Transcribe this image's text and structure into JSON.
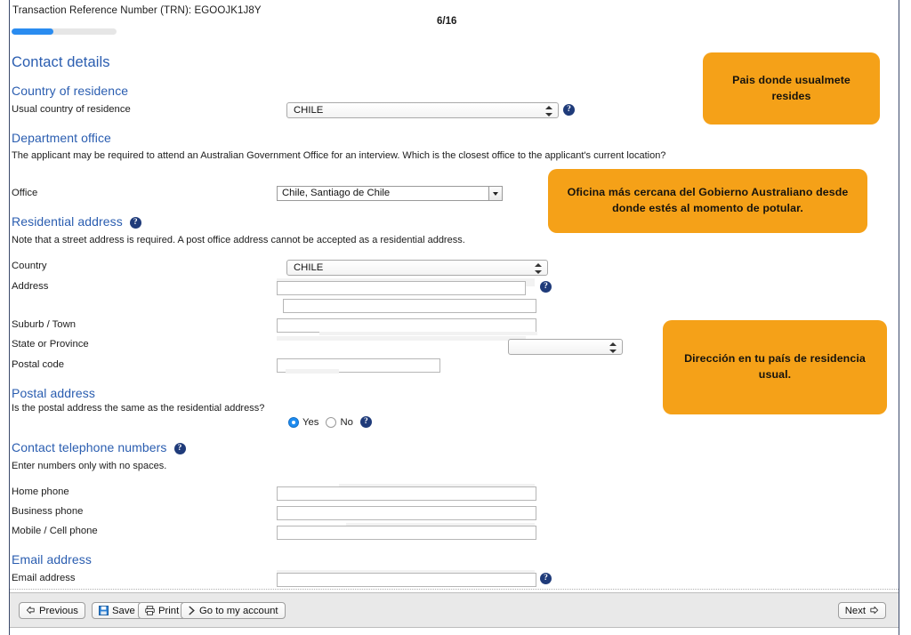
{
  "header": {
    "trn_label": "Transaction Reference Number (TRN): EGOOJK1J8Y",
    "page_counter": "6/16",
    "progress_percent": 40
  },
  "form": {
    "title": "Contact details",
    "sections": {
      "country_of_residence": {
        "heading": "Country of residence",
        "field_label": "Usual country of residence",
        "select_value": "CHILE"
      },
      "department_office": {
        "heading": "Department office",
        "note": "The applicant may be required to attend an Australian Government Office for an interview. Which is the closest office to the applicant's current location?",
        "field_label": "Office",
        "select_value": "Chile, Santiago de Chile"
      },
      "residential_address": {
        "heading": "Residential address",
        "note": "Note that a street address is required. A post office address cannot be accepted as a residential address.",
        "country_label": "Country",
        "country_value": "CHILE",
        "address_label": "Address",
        "address_line1": "",
        "address_line2": "",
        "suburb_label": "Suburb / Town",
        "suburb_value": "",
        "state_label": "State or Province",
        "state_value": "",
        "postal_code_label": "Postal code",
        "postal_code_value": ""
      },
      "postal_address": {
        "heading": "Postal address",
        "question": "Is the postal address the same as the residential address?",
        "option_yes": "Yes",
        "option_no": "No",
        "selected": "Yes"
      },
      "contact_telephone": {
        "heading": "Contact telephone numbers",
        "note": "Enter numbers only with no spaces.",
        "home_label": "Home phone",
        "home_value": "",
        "business_label": "Business phone",
        "business_value": "",
        "mobile_label": "Mobile / Cell phone",
        "mobile_value": ""
      },
      "email_address": {
        "heading": "Email address",
        "field_label": "Email address",
        "value": ""
      }
    }
  },
  "callouts": [
    {
      "text": "Pais donde usualmete resides"
    },
    {
      "text": "Oficina más cercana del Gobierno Australiano desde donde estés al momento de potular."
    },
    {
      "text": "Dirección en tu país de residencia usual."
    }
  ],
  "footer": {
    "previous_label": "Previous",
    "save_label": "Save",
    "print_label": "Print",
    "account_label": "Go to my account",
    "next_label": "Next"
  },
  "icons": {
    "help": "?"
  },
  "colors": {
    "heading_blue": "#2a5db0",
    "callout_orange": "#f5a118",
    "progress_blue": "#2a8cf0",
    "help_icon_navy": "#1f3b7a"
  }
}
